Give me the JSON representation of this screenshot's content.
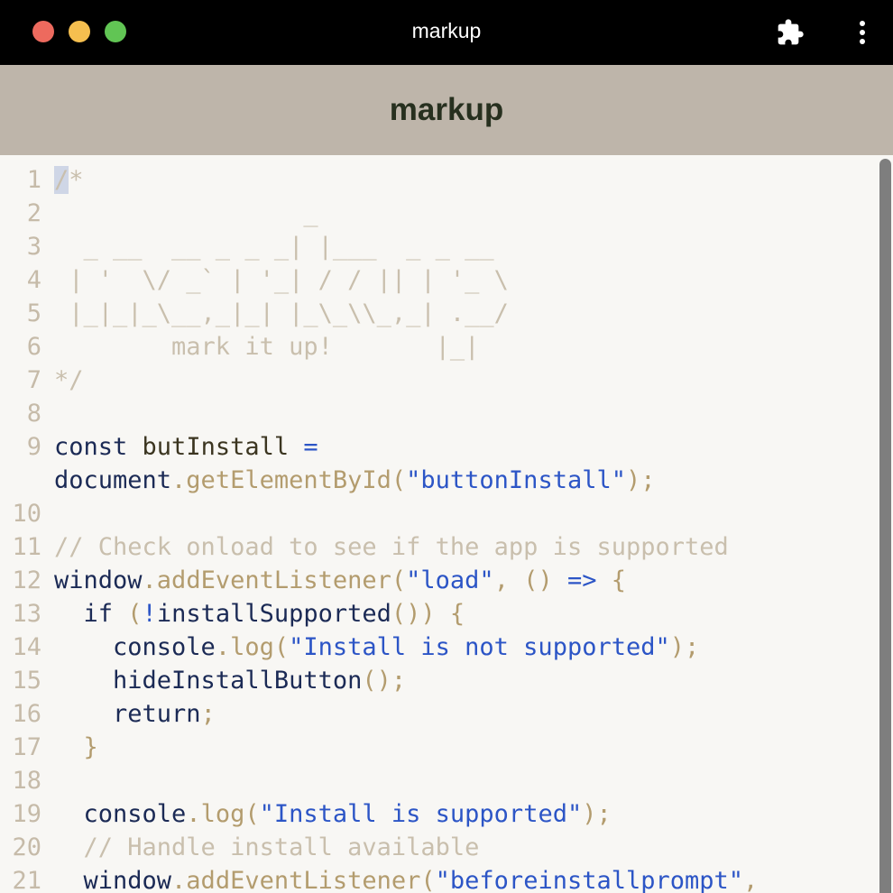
{
  "window": {
    "title": "markup",
    "icons": {
      "extensions": "puzzle-icon",
      "more": "vertical-dots-icon"
    },
    "traffic_lights": {
      "close": "#ed6a5e",
      "minimize": "#f5bf4f",
      "maximize": "#61c554"
    }
  },
  "app": {
    "title": "markup",
    "header_color": "#beb5aa"
  },
  "editor": {
    "background": "#f8f7f4",
    "lines": [
      {
        "num": "1",
        "tokens": [
          {
            "t": "/",
            "c": "cm sel"
          },
          {
            "t": "*",
            "c": "cm"
          }
        ]
      },
      {
        "num": "2",
        "tokens": [
          {
            "t": "                 _",
            "c": "cm"
          }
        ]
      },
      {
        "num": "3",
        "tokens": [
          {
            "t": "  _ __  __ _ _ _| |___  _ _ __",
            "c": "cm"
          }
        ]
      },
      {
        "num": "4",
        "tokens": [
          {
            "t": " | '  \\/ _` | '_| / / || | '_ \\",
            "c": "cm"
          }
        ]
      },
      {
        "num": "5",
        "tokens": [
          {
            "t": " |_|_|_\\__,_|_| |_\\_\\\\_,_| .__/",
            "c": "cm"
          }
        ]
      },
      {
        "num": "6",
        "tokens": [
          {
            "t": "        mark it up!       |_|",
            "c": "cm"
          }
        ]
      },
      {
        "num": "7",
        "tokens": [
          {
            "t": "*/",
            "c": "cm"
          }
        ]
      },
      {
        "num": "8",
        "tokens": []
      },
      {
        "num": "9",
        "tokens": [
          {
            "t": "const ",
            "c": "kw"
          },
          {
            "t": "butInstall",
            "c": "var"
          },
          {
            "t": " =",
            "c": "op"
          }
        ]
      },
      {
        "num": "",
        "tokens": [
          {
            "t": "document",
            "c": "kw"
          },
          {
            "t": ".getElementById(",
            "c": "fn"
          },
          {
            "t": "\"buttonInstall\"",
            "c": "st"
          },
          {
            "t": ");",
            "c": "pu"
          }
        ]
      },
      {
        "num": "10",
        "tokens": []
      },
      {
        "num": "11",
        "tokens": [
          {
            "t": "// Check onload to see if the app is supported",
            "c": "cm"
          }
        ]
      },
      {
        "num": "12",
        "tokens": [
          {
            "t": "window",
            "c": "kw"
          },
          {
            "t": ".addEventListener(",
            "c": "fn"
          },
          {
            "t": "\"load\"",
            "c": "st"
          },
          {
            "t": ", () ",
            "c": "pu"
          },
          {
            "t": "=>",
            "c": "op"
          },
          {
            "t": " {",
            "c": "pu"
          }
        ]
      },
      {
        "num": "13",
        "tokens": [
          {
            "t": "  if ",
            "c": "kw"
          },
          {
            "t": "(",
            "c": "pu"
          },
          {
            "t": "!",
            "c": "op"
          },
          {
            "t": "installSupported",
            "c": "kw"
          },
          {
            "t": "()) {",
            "c": "pu"
          }
        ]
      },
      {
        "num": "14",
        "tokens": [
          {
            "t": "    console",
            "c": "kw"
          },
          {
            "t": ".log(",
            "c": "fn"
          },
          {
            "t": "\"Install is not supported\"",
            "c": "st"
          },
          {
            "t": ");",
            "c": "pu"
          }
        ]
      },
      {
        "num": "15",
        "tokens": [
          {
            "t": "    hideInstallButton",
            "c": "kw"
          },
          {
            "t": "();",
            "c": "pu"
          }
        ]
      },
      {
        "num": "16",
        "tokens": [
          {
            "t": "    return",
            "c": "kw"
          },
          {
            "t": ";",
            "c": "pu"
          }
        ]
      },
      {
        "num": "17",
        "tokens": [
          {
            "t": "  }",
            "c": "pu"
          }
        ]
      },
      {
        "num": "18",
        "tokens": []
      },
      {
        "num": "19",
        "tokens": [
          {
            "t": "  console",
            "c": "kw"
          },
          {
            "t": ".log(",
            "c": "fn"
          },
          {
            "t": "\"Install is supported\"",
            "c": "st"
          },
          {
            "t": ");",
            "c": "pu"
          }
        ]
      },
      {
        "num": "20",
        "tokens": [
          {
            "t": "  // Handle install available",
            "c": "cm"
          }
        ]
      },
      {
        "num": "21",
        "tokens": [
          {
            "t": "  window",
            "c": "kw"
          },
          {
            "t": ".addEventListener(",
            "c": "fn"
          },
          {
            "t": "\"beforeinstallprompt\"",
            "c": "st"
          },
          {
            "t": ",",
            "c": "pu"
          }
        ]
      }
    ]
  }
}
